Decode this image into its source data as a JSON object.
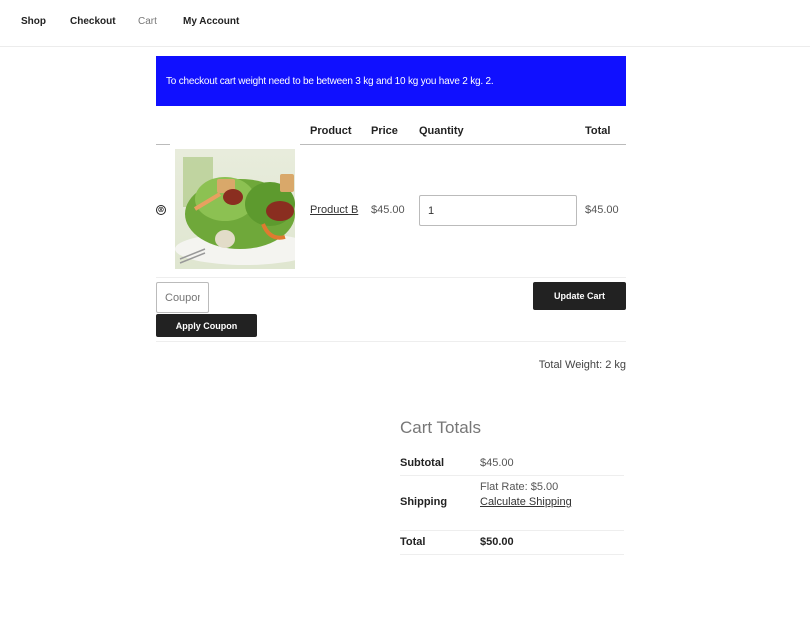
{
  "nav": {
    "items": [
      {
        "label": "Shop"
      },
      {
        "label": "Checkout"
      },
      {
        "label": "Cart",
        "current": true
      },
      {
        "label": "My Account"
      }
    ]
  },
  "notice": {
    "text": "To checkout cart weight need to be between 3 kg and 10 kg you have 2 kg.  2.",
    "color": "#1010ff"
  },
  "cart_table": {
    "headers": {
      "product": "Product",
      "price": "Price",
      "quantity": "Quantity",
      "total": "Total"
    },
    "rows": [
      {
        "remove_icon": "⊗",
        "thumbnail": "salad-image",
        "product": "Product B",
        "price": "$45.00",
        "quantity": "1",
        "total": "$45.00"
      }
    ]
  },
  "actions": {
    "coupon_placeholder": "Coupon code",
    "apply_coupon": "Apply Coupon",
    "update_cart": "Update Cart"
  },
  "weight": {
    "text": "Total Weight: 2 kg"
  },
  "totals": {
    "title": "Cart Totals",
    "subtotal_label": "Subtotal",
    "subtotal_value": "$45.00",
    "shipping_label": "Shipping",
    "shipping_rate": "Flat Rate: $5.00",
    "calculate_shipping": "Calculate Shipping",
    "total_label": "Total",
    "total_value": "$50.00"
  }
}
